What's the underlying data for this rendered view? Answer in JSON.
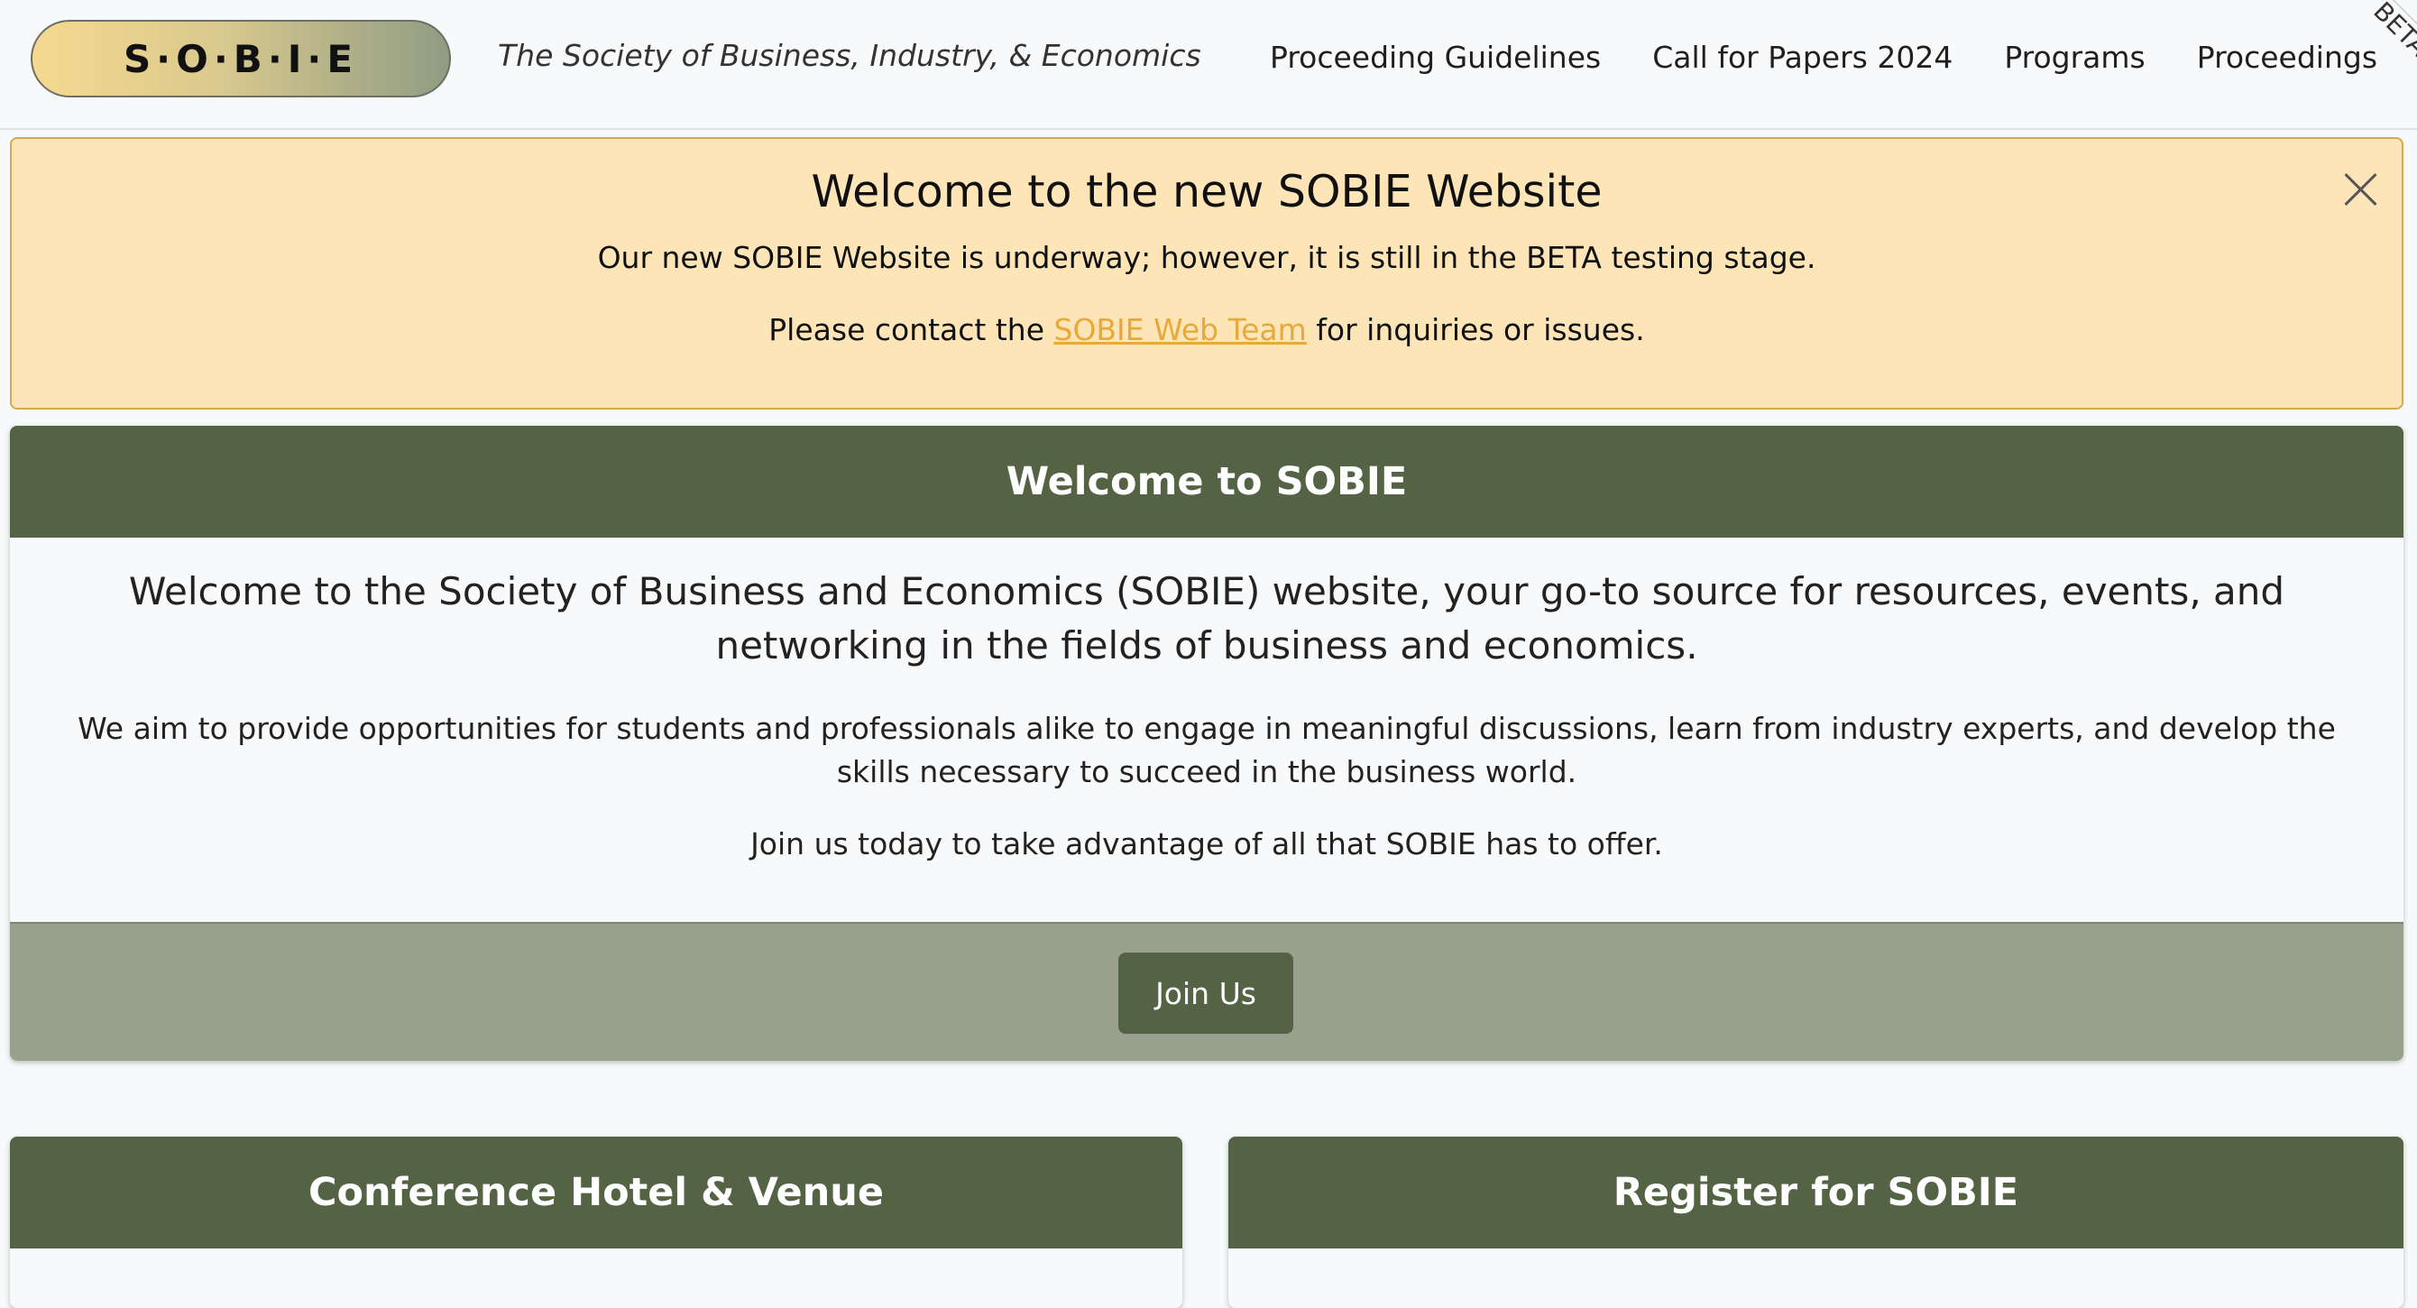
{
  "navbar": {
    "brand": "S·O·B·I·E",
    "tagline": "The Society of Business, Industry, & Economics",
    "links": [
      "Proceeding Guidelines",
      "Call for Papers 2024",
      "Programs",
      "Proceedings"
    ],
    "beta": "BETA"
  },
  "alert": {
    "title": "Welcome to the new SOBIE Website",
    "line1": "Our new SOBIE Website is underway; however, it is still in the BETA testing stage.",
    "line2_pre": "Please contact the",
    "link": "SOBIE Web Team",
    "line2_post": "for inquiries or issues.",
    "close_icon": "close-icon"
  },
  "welcome": {
    "header": "Welcome to SOBIE",
    "lead": "Welcome to the Society of Business and Economics (SOBIE) website, your go-to source for resources, events, and networking in the fields of business and economics.",
    "p1": "We aim to provide opportunities for students and professionals alike to engage in meaningful discussions, learn from industry experts, and develop the skills necessary to succeed in the business world.",
    "p2": "Join us today to take advantage of all that SOBIE has to offer.",
    "button": "Join Us"
  },
  "cards": {
    "hotel_header": "Conference Hotel & Venue",
    "register_header": "Register for SOBIE"
  },
  "colors": {
    "primary": "#556345",
    "footer": "#98a18e",
    "alert_bg": "#fde5b7",
    "link": "#e8a93a"
  }
}
